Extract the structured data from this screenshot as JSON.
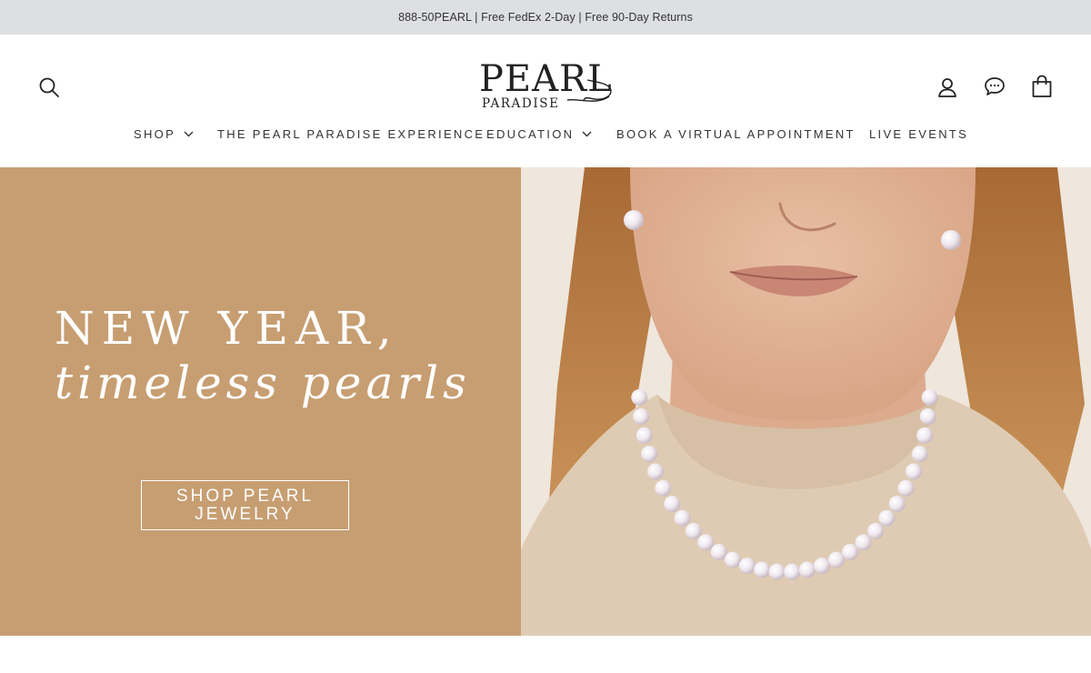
{
  "announcement": {
    "text": "888-50PEARL | Free FedEx 2-Day | Free 90-Day Returns"
  },
  "header": {
    "logo": {
      "main": "PEARL",
      "sub": "PARADISE"
    },
    "icons": {
      "search": "search-icon",
      "account": "user-icon",
      "chat": "chat-icon",
      "cart": "cart-icon"
    }
  },
  "nav": {
    "items": [
      {
        "label": "SHOP",
        "has_dropdown": true
      },
      {
        "label": "THE PEARL PARADISE EXPERIENCE",
        "has_dropdown": false
      },
      {
        "label": "EDUCATION",
        "has_dropdown": true
      },
      {
        "label": "BOOK A VIRTUAL APPOINTMENT",
        "has_dropdown": false
      },
      {
        "label": "LIVE EVENTS",
        "has_dropdown": false
      }
    ]
  },
  "hero": {
    "headline_line1": "NEW YEAR,",
    "headline_line2": "timeless pearls",
    "cta_label": "SHOP PEARL JEWELRY",
    "colors": {
      "panel": "#c79e72",
      "text": "#ffffff"
    },
    "image": "woman-wearing-pearl-necklace-and-earrings"
  }
}
